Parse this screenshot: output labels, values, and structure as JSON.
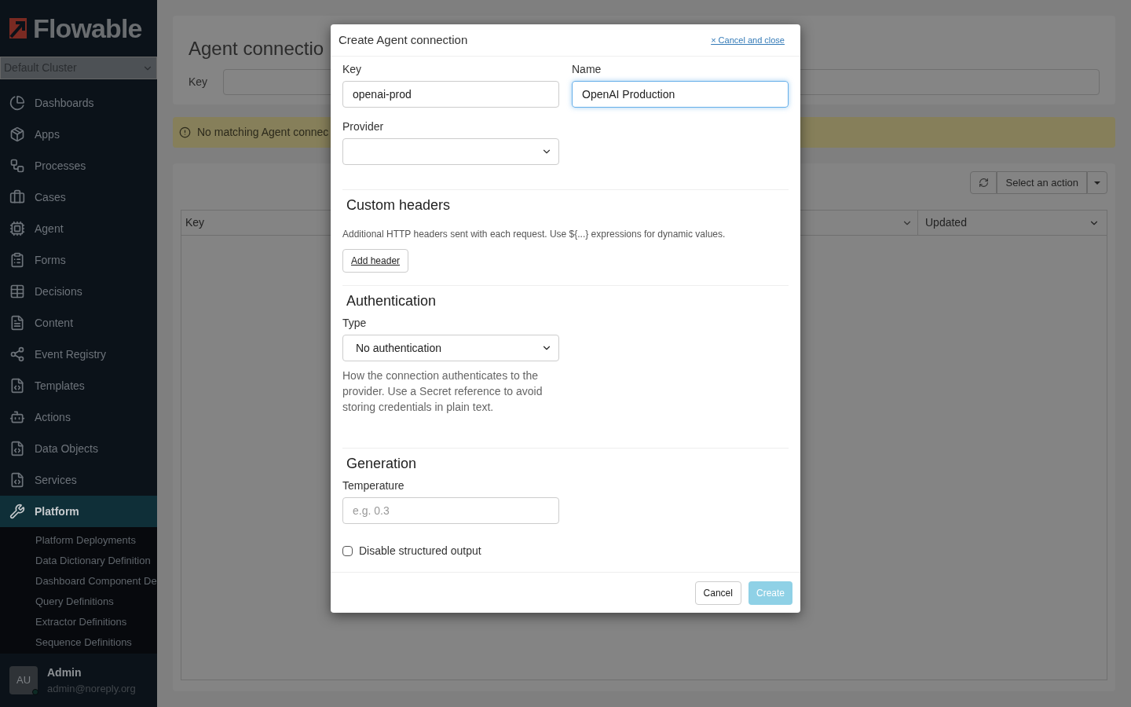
{
  "sidebar": {
    "logo": "Flowable",
    "cluster_select": "Default Cluster",
    "items": [
      {
        "label": "Dashboards",
        "selected": false
      },
      {
        "label": "Apps",
        "selected": false
      },
      {
        "label": "Processes",
        "selected": false
      },
      {
        "label": "Cases",
        "selected": false
      },
      {
        "label": "Agent",
        "selected": false
      },
      {
        "label": "Forms",
        "selected": false
      },
      {
        "label": "Decisions",
        "selected": false
      },
      {
        "label": "Content",
        "selected": false
      },
      {
        "label": "Event Registry",
        "selected": false
      },
      {
        "label": "Templates",
        "selected": false
      },
      {
        "label": "Actions",
        "selected": false
      },
      {
        "label": "Data Objects",
        "selected": false
      },
      {
        "label": "Services",
        "selected": false
      },
      {
        "label": "Platform",
        "selected": true
      }
    ],
    "subitems": [
      "Platform Deployments",
      "Data Dictionary Definition",
      "Dashboard Component De",
      "Query Definitions",
      "Extractor Definitions",
      "Sequence Definitions"
    ],
    "user": {
      "initials": "AU",
      "name": "Admin",
      "email": "admin@noreply.org"
    }
  },
  "page": {
    "title": "Agent connectio",
    "filter_label": "Key",
    "alert": "No matching Agent connec",
    "action_select": "Select an action",
    "columns": [
      "Key",
      "Updated"
    ]
  },
  "dialog": {
    "title": "Create Agent connection",
    "close_link": "× Cancel and close",
    "key": {
      "label": "Key",
      "value": "openai-prod",
      "focused": false
    },
    "name": {
      "label": "Name",
      "value": "OpenAI Production",
      "focused": true
    },
    "provider": {
      "label": "Provider"
    },
    "custom_headers": {
      "heading": "Custom headers",
      "help": "Additional HTTP headers sent with each request. Use ${...} expressions for dynamic values.",
      "button": "Add header"
    },
    "authentication": {
      "heading": "Authentication",
      "type_label": "Type",
      "type_value": "No authentication",
      "help": "How the connection authenticates to the provider. Use a Secret reference to avoid storing credentials in plain text."
    },
    "generation": {
      "heading": "Generation",
      "temperature_label": "Temperature",
      "temperature_placeholder": "e.g. 0.3",
      "checkbox": {
        "label": "Disable structured output",
        "checked": false
      }
    },
    "buttons": {
      "cancel": "Cancel",
      "create": "Create",
      "create_disabled": true
    }
  }
}
